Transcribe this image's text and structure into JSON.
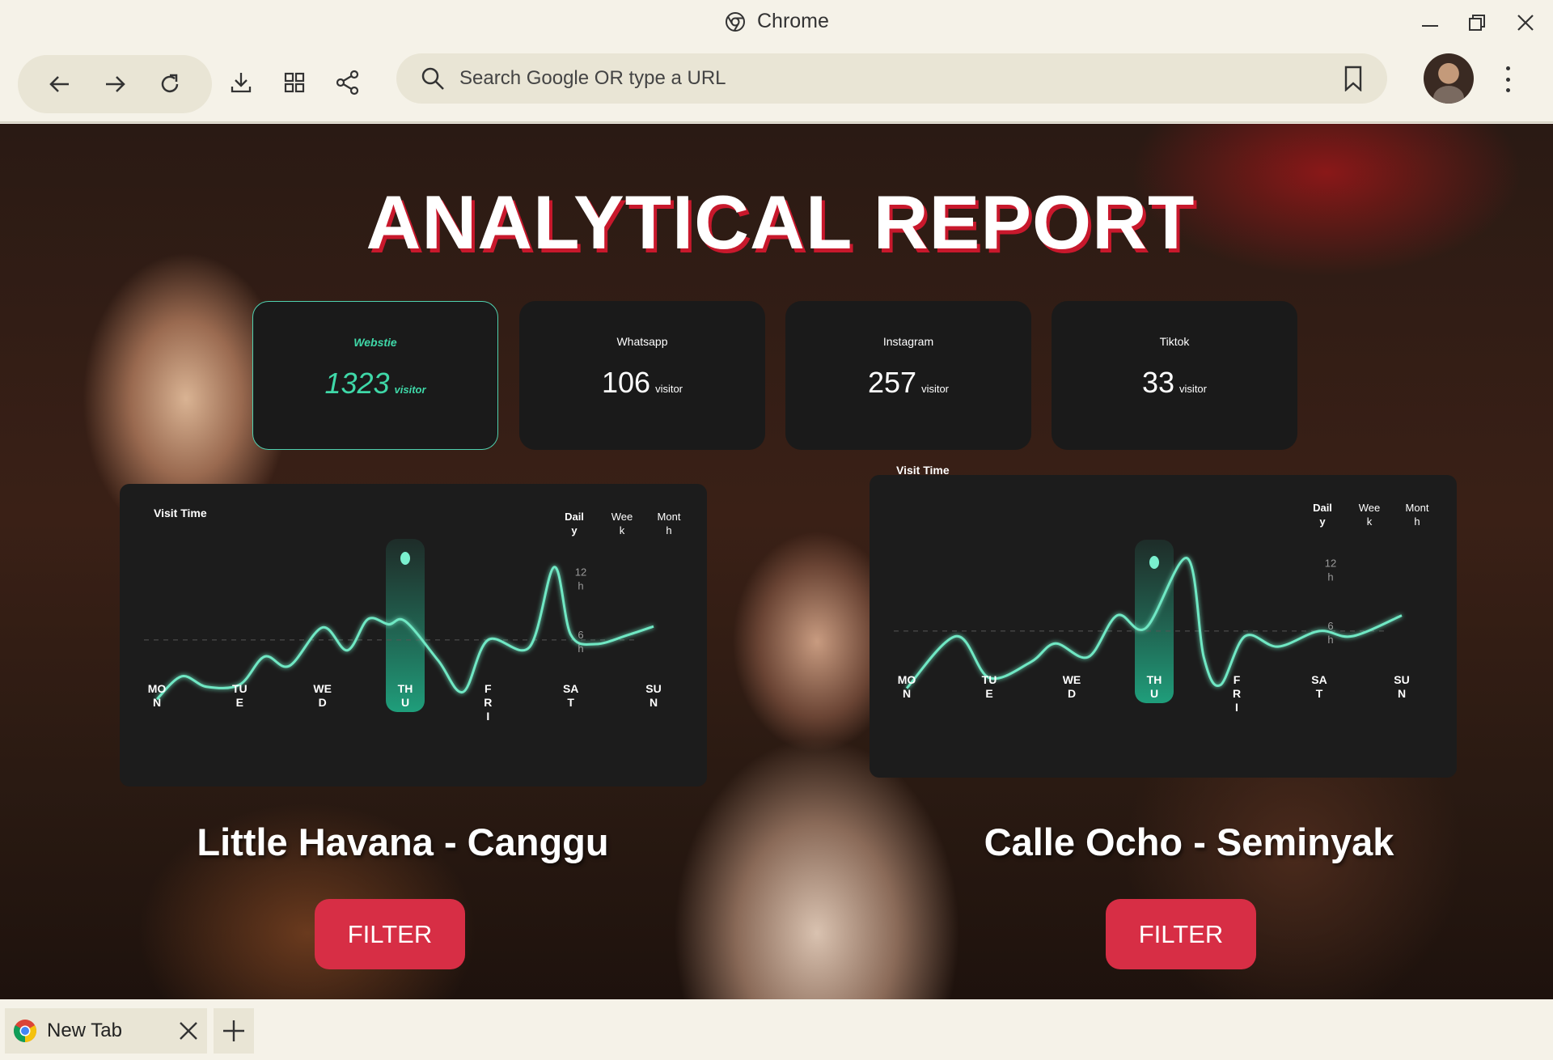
{
  "browser": {
    "title": "Chrome",
    "search_placeholder": "Search Google OR type a URL",
    "tab_title": "New Tab"
  },
  "page": {
    "heading": "ANALYTICAL REPORT",
    "stats": [
      {
        "label": "Webstie",
        "value": "1323",
        "unit": "visitor"
      },
      {
        "label": "Whatsapp",
        "value": "106",
        "unit": "visitor"
      },
      {
        "label": "Instagram",
        "value": "257",
        "unit": "visitor"
      },
      {
        "label": "Tiktok",
        "value": "33",
        "unit": "visitor"
      }
    ],
    "chart_title": "Visit Time",
    "ranges": [
      "Dail\ny",
      "Wee\nk",
      "Mont\nh"
    ],
    "y_ticks": [
      "12\nh",
      "6\nh"
    ],
    "days": [
      "MO\nN",
      "TU\nE",
      "WE\nD",
      "TH\nU",
      "F\nR\nI",
      "SA\nT",
      "SU\nN"
    ],
    "locations": [
      {
        "name": "Little Havana - Canggu",
        "button": "FILTER"
      },
      {
        "name": "Calle Ocho - Seminyak",
        "button": "FILTER"
      }
    ]
  },
  "colors": {
    "accent": "#4fd1b0",
    "danger": "#d72e45",
    "title_shadow": "#c8182c",
    "card": "#1a1a1a"
  },
  "chart_data": [
    {
      "type": "line",
      "title": "Visit Time",
      "categories": [
        "MON",
        "TUE",
        "WED",
        "THU",
        "FRI",
        "SAT",
        "SUN"
      ],
      "x": [
        0,
        0.3,
        0.6,
        1,
        1.3,
        1.6,
        2,
        2.3,
        2.55,
        2.8,
        3,
        3.4,
        3.7,
        4,
        4.5,
        4.8,
        5,
        5.3,
        5.7,
        6
      ],
      "y": [
        0.3,
        2.5,
        1.5,
        1.7,
        4.4,
        3.5,
        7.2,
        5.0,
        8.0,
        7.5,
        7.8,
        4.0,
        1.0,
        6.0,
        5.3,
        13.0,
        6.5,
        5.6,
        6.5,
        7.3
      ],
      "highlight": "THU",
      "y_ticks": [
        "12h",
        "6h"
      ],
      "ylim": [
        0,
        14
      ],
      "ranges": [
        "Daily",
        "Week",
        "Month"
      ],
      "selected_range": "Daily"
    },
    {
      "type": "line",
      "title": "Visit Time",
      "categories": [
        "MON",
        "TUE",
        "WED",
        "THU",
        "FRI",
        "SAT",
        "SUN"
      ],
      "x": [
        0,
        0.6,
        1,
        1.5,
        1.8,
        2.2,
        2.55,
        2.9,
        3.4,
        3.6,
        3.8,
        4.1,
        4.5,
        5,
        5.4,
        6
      ],
      "y": [
        0.5,
        5.5,
        1.5,
        3.0,
        4.8,
        3.5,
        7.5,
        6.3,
        13.0,
        3.5,
        0.8,
        5.5,
        4.5,
        6.0,
        5.5,
        7.5
      ],
      "highlight": "THU",
      "y_ticks": [
        "12h",
        "6h"
      ],
      "ylim": [
        0,
        14
      ],
      "ranges": [
        "Daily",
        "Week",
        "Month"
      ],
      "selected_range": "Daily"
    }
  ]
}
